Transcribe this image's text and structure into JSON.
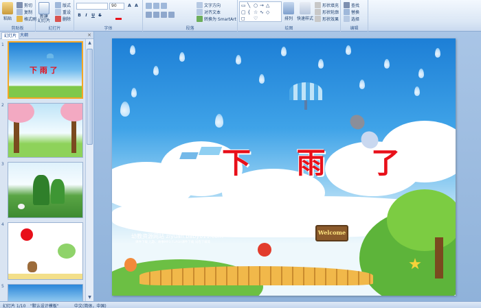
{
  "ribbon": {
    "clipboard": {
      "label": "剪贴板",
      "paste": "粘贴",
      "cut": "剪切",
      "copy": "复制",
      "format_painter": "格式刷"
    },
    "slides": {
      "label": "幻灯片",
      "new_slide": "新建\n幻灯片",
      "layout": "版式",
      "reset": "重设",
      "delete": "删除"
    },
    "font": {
      "label": "字体",
      "size": "90",
      "bold": "B",
      "italic": "I",
      "underline": "U",
      "strike": "S"
    },
    "paragraph": {
      "label": "段落",
      "text_direction": "文字方向",
      "align_text": "对齐文本",
      "smartart": "转换为 SmartArt"
    },
    "drawing": {
      "label": "绘图",
      "arrange": "排列",
      "quick_styles": "快速样式",
      "shape_fill": "形状填充",
      "shape_outline": "形状轮廓",
      "shape_effects": "形状效果"
    },
    "editing": {
      "label": "编辑",
      "find": "查找",
      "replace": "替换",
      "select": "选择"
    }
  },
  "left_panel": {
    "tabs": [
      {
        "label": "幻灯片"
      },
      {
        "label": "大纲"
      }
    ],
    "close": "×",
    "slides": [
      {
        "num": "1",
        "title": "下 雨 了"
      },
      {
        "num": "2"
      },
      {
        "num": "3"
      },
      {
        "num": "4"
      },
      {
        "num": "5"
      }
    ]
  },
  "slide": {
    "title": "下 雨 了",
    "site_name": "幼教资源网站 ziyuan.baby611.com",
    "site_sub": "课件下载  儿歌、故事MP3  FLASH课件下载  试卷下载等",
    "sign": "Welcome"
  },
  "status": {
    "slide": "幻灯片 1/10",
    "theme": "\"默认设计模板\"",
    "language": "中文(简体，中国)"
  },
  "colors": {
    "title_red": "#e8101a",
    "sky_blue": "#1d7fd6",
    "selection_orange": "#f5a623"
  }
}
